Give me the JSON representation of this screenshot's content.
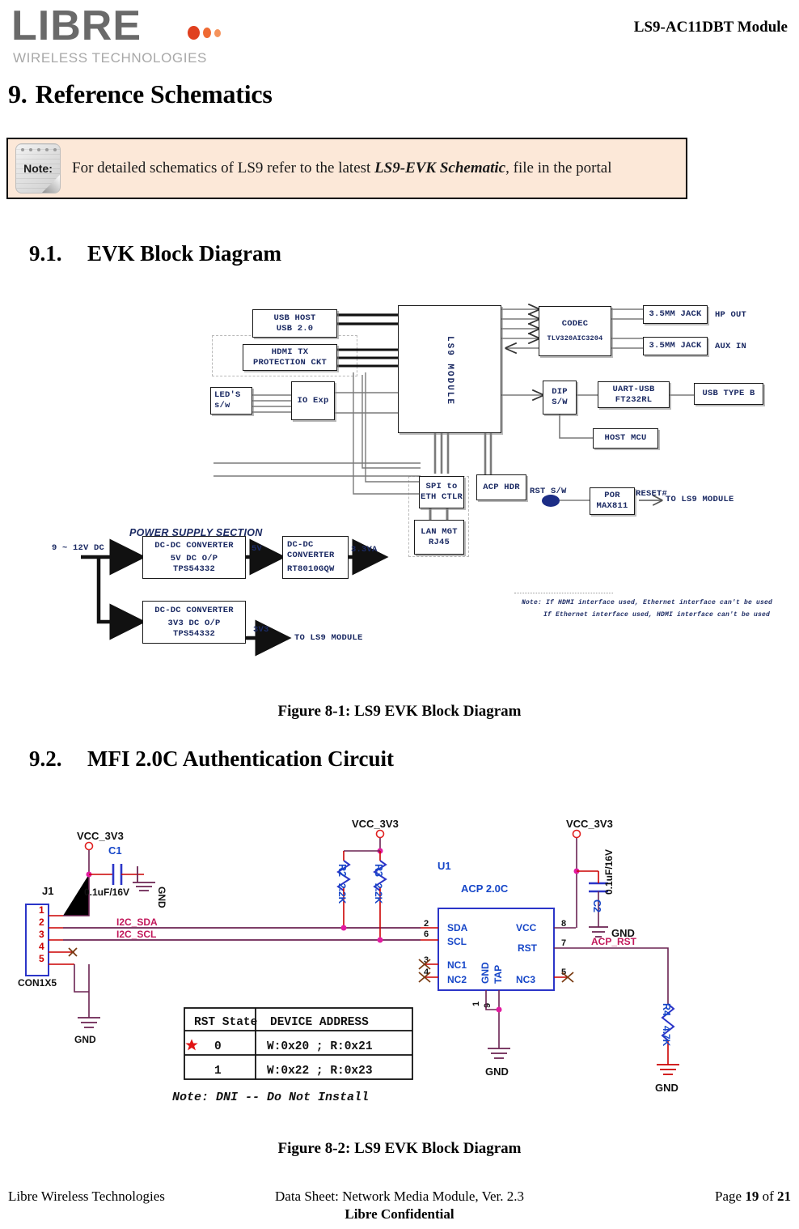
{
  "header": {
    "logo_word": "LIBRE",
    "logo_sub": "WIRELESS TECHNOLOGIES",
    "doc_title": "LS9-AC11DBT Module"
  },
  "section": {
    "number": "9.",
    "title": "Reference Schematics"
  },
  "note": {
    "icon_label": "Note:",
    "text_before": "For detailed schematics of LS9 refer to the latest ",
    "emphasis": "LS9-EVK Schematic",
    "text_after": ", file in the portal"
  },
  "subsections": [
    {
      "number": "9.1.",
      "title": "EVK  Block Diagram"
    },
    {
      "number": "9.2.",
      "title": "MFI 2.0C Authentication Circuit"
    }
  ],
  "figures": [
    {
      "caption": "Figure 8-1: LS9 EVK Block Diagram"
    },
    {
      "caption": "Figure 8-2: LS9 EVK Block Diagram"
    }
  ],
  "block_diagram": {
    "blocks": {
      "usb_host": {
        "line1": "USB HOST",
        "line2": "USB 2.0"
      },
      "hdmi_tx": {
        "line1": "HDMI TX",
        "line2": "PROTECTION CKT"
      },
      "leds_sw": {
        "line1": "LED'S",
        "line2": "s/w"
      },
      "io_exp": {
        "line1": "IO Exp"
      },
      "ls9_module": {
        "line1": "LS9 MODULE"
      },
      "codec": {
        "line1": "CODEC",
        "line2": "TLV320AIC3204"
      },
      "jack_hp": {
        "line1": "3.5MM JACK"
      },
      "jack_aux": {
        "line1": "3.5MM JACK"
      },
      "dip_sw": {
        "line1": "DIP",
        "line2": "S/W"
      },
      "uart_usb": {
        "line1": "UART-USB",
        "line2": "FT232RL"
      },
      "usb_type_b": {
        "line1": "USB TYPE B"
      },
      "host_mcu": {
        "line1": "HOST MCU"
      },
      "spi_eth": {
        "line1": "SPI to",
        "line2": "ETH CTLR"
      },
      "lan_mgt": {
        "line1": "LAN MGT",
        "line2": "RJ45"
      },
      "acp_hdr": {
        "line1": "ACP HDR"
      },
      "por": {
        "line1": "POR",
        "line2": "MAX811"
      },
      "dcdc_5v": {
        "line1": "DC-DC CONVERTER",
        "line2": "5V DC O/P",
        "line3": "TPS54332"
      },
      "dcdc_33": {
        "line1": "DC-DC",
        "line2": "CONVERTER",
        "line3": "RT8010GQW"
      },
      "dcdc_3v3": {
        "line1": "DC-DC CONVERTER",
        "line2": "3V3 DC O/P",
        "line3": "TPS54332"
      }
    },
    "labels": {
      "hp_out": "HP OUT",
      "aux_in": "AUX IN",
      "rst_sw": "RST S/W",
      "reset_hash": "RESET#",
      "to_ls9_module_reset": "TO LS9 MODULE",
      "power_supply_section": "POWER SUPPLY SECTION",
      "input_voltage": "9 ~ 12V DC",
      "rail_5v": "5V",
      "rail_3v3a": "3.3VA",
      "rail_3v3": "3V3",
      "to_ls9_module_power": "TO LS9 MODULE",
      "note_line1": "Note: If HDMI interface used, Ethernet interface can't be used",
      "note_line2": "If Ethernet interface used, HDMI interface can't be used"
    }
  },
  "mfi_schematic": {
    "connector": {
      "refdes": "J1",
      "part": "CON1X5",
      "pins": [
        "1",
        "2",
        "3",
        "4",
        "5"
      ]
    },
    "nets": {
      "vcc": "VCC_3V3",
      "gnd": "GND",
      "i2c_sda": "I2C_SDA",
      "i2c_scl": "I2C_SCL",
      "acp_rst": "ACP_RST"
    },
    "components": [
      {
        "refdes": "C1",
        "value": "0.1uF/16V"
      },
      {
        "refdes": "R2",
        "value": "2.2K"
      },
      {
        "refdes": "R3",
        "value": "2.2K"
      },
      {
        "refdes": "C2",
        "value": "0.1uF/16V"
      },
      {
        "refdes": "R4",
        "value": "4.7K"
      }
    ],
    "u1": {
      "refdes": "U1",
      "part": "ACP 2.0C",
      "left_pins": [
        {
          "num": "2",
          "name": "SDA"
        },
        {
          "num": "6",
          "name": "SCL"
        },
        {
          "num": "3",
          "name": "NC1"
        },
        {
          "num": "4",
          "name": "NC2"
        }
      ],
      "right_pins": [
        {
          "num": "8",
          "name": "VCC"
        },
        {
          "num": "7",
          "name": "RST"
        },
        {
          "num": "5",
          "name": "NC3"
        }
      ],
      "bottom_pins": [
        {
          "num": "1",
          "name": "GND"
        },
        {
          "num": "9",
          "name": "TAP"
        }
      ]
    },
    "table": {
      "headers": [
        "RST State",
        "DEVICE ADDRESS"
      ],
      "rows": [
        {
          "marked": true,
          "state": "0",
          "address": "W:0x20 ; R:0x21"
        },
        {
          "marked": false,
          "state": "1",
          "address": "W:0x22 ; R:0x23"
        }
      ]
    },
    "note": "Note: DNI -- Do Not Install"
  },
  "footer": {
    "left": "Libre Wireless Technologies",
    "middle": "Data Sheet: Network Media Module, Ver. 2.3",
    "page_prefix": "Page ",
    "page_number": "19",
    "page_of": " of ",
    "page_total": "21",
    "confidential": "Libre Confidential"
  }
}
